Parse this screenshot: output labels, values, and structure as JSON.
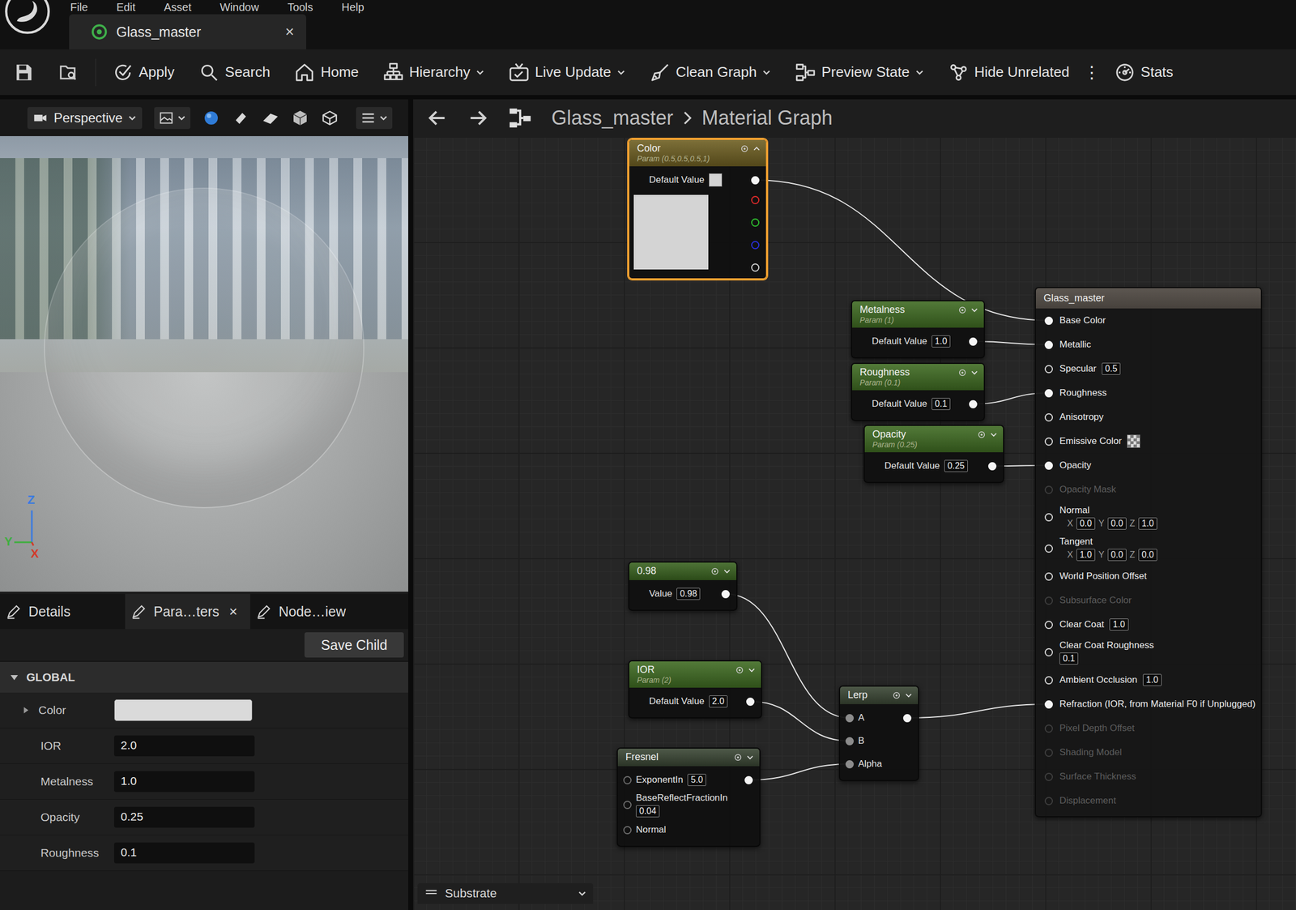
{
  "window": {
    "title": "Glass_master"
  },
  "menu": [
    "File",
    "Edit",
    "Asset",
    "Window",
    "Tools",
    "Help"
  ],
  "close_glyph": "×",
  "toolbar": [
    {
      "label": "Apply",
      "kind": "button"
    },
    {
      "label": "Search",
      "kind": "button"
    },
    {
      "label": "Home",
      "kind": "button"
    },
    {
      "label": "Hierarchy",
      "kind": "dropdown"
    },
    {
      "label": "Live Update",
      "kind": "dropdown"
    },
    {
      "label": "Clean Graph",
      "kind": "dropdown"
    },
    {
      "label": "Preview State",
      "kind": "dropdown"
    },
    {
      "label": "Hide Unrelated",
      "kind": "button"
    },
    {
      "label": "⋮",
      "kind": "more"
    },
    {
      "label": "Stats",
      "kind": "button"
    }
  ],
  "viewport": {
    "view": "Perspective",
    "axes": [
      {
        "label": "Z",
        "color": "#3b7be0"
      },
      {
        "label": "Y",
        "color": "#3fae3f"
      },
      {
        "label": "X",
        "color": "#d23a2a"
      }
    ]
  },
  "panel_tabs": [
    {
      "label": "Details",
      "selected": false,
      "closable": false
    },
    {
      "label": "Para…ters",
      "selected": true,
      "closable": true
    },
    {
      "label": "Node…iew",
      "selected": false,
      "closable": false
    }
  ],
  "details": {
    "save_button": "Save Child",
    "section": {
      "label": "GLOBAL",
      "expanded": true
    },
    "params": [
      {
        "label": "Color",
        "kind": "color",
        "value": "#dadada",
        "expanded": false
      },
      {
        "label": "IOR",
        "kind": "number",
        "value": "2.0"
      },
      {
        "label": "Metalness",
        "kind": "number",
        "value": "1.0"
      },
      {
        "label": "Opacity",
        "kind": "number",
        "value": "0.25"
      },
      {
        "label": "Roughness",
        "kind": "number",
        "value": "0.1"
      }
    ]
  },
  "graph": {
    "breadcrumb": [
      "Glass_master",
      "Material Graph"
    ],
    "nodes": [
      {
        "title": "Color",
        "subtitle": "Param (0.5,0.5,0.5,1)",
        "color": "#6e5f22",
        "selected": true,
        "expanded": true,
        "preview": "#d4d4d4",
        "channels": [
          "#e02a2a",
          "#2ec02e",
          "#2a30e0",
          "#d0d0d0"
        ],
        "rows": [
          {
            "label": "Default Value",
            "swatch": "#d4d4d4",
            "input": false,
            "connected": false,
            "output": true,
            "below": false
          }
        ]
      },
      {
        "title": "Metalness",
        "subtitle": "Param (1)",
        "color": "#3f6b22",
        "selected": false,
        "expanded": false,
        "rows": [
          {
            "label": "Default Value",
            "value": "1.0",
            "input": false,
            "connected": false,
            "output": true,
            "below": false
          }
        ]
      },
      {
        "title": "Roughness",
        "subtitle": "Param (0.1)",
        "color": "#3f6b22",
        "selected": false,
        "expanded": false,
        "rows": [
          {
            "label": "Default Value",
            "value": "0.1",
            "input": false,
            "connected": false,
            "output": true,
            "below": false
          }
        ]
      },
      {
        "title": "Opacity",
        "subtitle": "Param (0.25)",
        "color": "#3f6b22",
        "selected": false,
        "expanded": false,
        "rows": [
          {
            "label": "Default Value",
            "value": "0.25",
            "input": false,
            "connected": false,
            "output": true,
            "below": false
          }
        ]
      },
      {
        "title": "0.98",
        "color": "#3a6320",
        "selected": false,
        "expanded": false,
        "rows": [
          {
            "label": "Value",
            "value": "0.98",
            "input": false,
            "connected": false,
            "output": true,
            "below": false
          }
        ]
      },
      {
        "title": "IOR",
        "subtitle": "Param (2)",
        "color": "#3f6b22",
        "selected": false,
        "expanded": false,
        "rows": [
          {
            "label": "Default Value",
            "value": "2.0",
            "input": false,
            "connected": false,
            "output": true,
            "below": false
          }
        ]
      },
      {
        "title": "Fresnel",
        "color": "#3a4634",
        "selected": false,
        "expanded": false,
        "rows": [
          {
            "label": "ExponentIn",
            "value": "5.0",
            "input": true,
            "connected": false,
            "output": true,
            "below": false
          },
          {
            "label": "BaseReflectFractionIn",
            "value": "0.04",
            "input": true,
            "connected": false,
            "output": false,
            "below": true
          },
          {
            "label": "Normal",
            "input": true,
            "connected": false,
            "output": false,
            "below": false
          }
        ]
      },
      {
        "title": "Lerp",
        "color": "#3a4634",
        "selected": false,
        "expanded": false,
        "rows": [
          {
            "label": "A",
            "input": true,
            "connected": true,
            "output": true,
            "below": false
          },
          {
            "label": "B",
            "input": true,
            "connected": true,
            "output": false,
            "below": false
          },
          {
            "label": "Alpha",
            "input": true,
            "connected": true,
            "output": false,
            "below": false
          }
        ]
      }
    ],
    "material": {
      "title": "Glass_master",
      "rows": [
        {
          "label": "Base Color",
          "kind": "pin",
          "connected": true,
          "enabled": true
        },
        {
          "label": "Metallic",
          "kind": "pin",
          "connected": true,
          "enabled": true
        },
        {
          "label": "Specular",
          "kind": "value",
          "value": "0.5",
          "connected": false,
          "enabled": true
        },
        {
          "label": "Roughness",
          "kind": "pin",
          "connected": true,
          "enabled": true
        },
        {
          "label": "Anisotropy",
          "kind": "pin",
          "connected": false,
          "enabled": true
        },
        {
          "label": "Emissive Color",
          "kind": "swatch",
          "connected": false,
          "enabled": true
        },
        {
          "label": "Opacity",
          "kind": "pin",
          "connected": true,
          "enabled": true
        },
        {
          "label": "Opacity Mask",
          "kind": "pin",
          "connected": false,
          "enabled": false
        },
        {
          "label": "Normal",
          "kind": "vector",
          "connected": false,
          "enabled": true,
          "values": [
            {
              "axis": "X",
              "value": "0.0"
            },
            {
              "axis": "Y",
              "value": "0.0"
            },
            {
              "axis": "Z",
              "value": "1.0"
            }
          ]
        },
        {
          "label": "Tangent",
          "kind": "vector",
          "connected": false,
          "enabled": true,
          "values": [
            {
              "axis": "X",
              "value": "1.0"
            },
            {
              "axis": "Y",
              "value": "0.0"
            },
            {
              "axis": "Z",
              "value": "0.0"
            }
          ]
        },
        {
          "label": "World Position Offset",
          "kind": "pin",
          "connected": false,
          "enabled": true
        },
        {
          "label": "Subsurface Color",
          "kind": "pin",
          "connected": false,
          "enabled": false
        },
        {
          "label": "Clear Coat",
          "kind": "value",
          "value": "1.0",
          "connected": false,
          "enabled": true
        },
        {
          "label": "Clear Coat Roughness",
          "kind": "value-below",
          "value": "0.1",
          "connected": false,
          "enabled": true
        },
        {
          "label": "Ambient Occlusion",
          "kind": "value",
          "value": "1.0",
          "connected": false,
          "enabled": true
        },
        {
          "label": "Refraction (IOR, from Material F0 if Unplugged)",
          "kind": "pin",
          "connected": true,
          "enabled": true
        },
        {
          "label": "Pixel Depth Offset",
          "kind": "pin",
          "connected": false,
          "enabled": false
        },
        {
          "label": "Shading Model",
          "kind": "pin",
          "connected": false,
          "enabled": false
        },
        {
          "label": "Surface Thickness",
          "kind": "pin",
          "connected": false,
          "enabled": false
        },
        {
          "label": "Displacement",
          "kind": "pin",
          "connected": false,
          "enabled": false
        }
      ]
    },
    "wires": [
      {
        "from": "Color",
        "to": "Glass_master",
        "pin": "Base Color"
      },
      {
        "from": "Metalness",
        "to": "Glass_master",
        "pin": "Metallic"
      },
      {
        "from": "Roughness",
        "to": "Glass_master",
        "pin": "Roughness"
      },
      {
        "from": "Opacity",
        "to": "Glass_master",
        "pin": "Opacity"
      },
      {
        "from": "0.98",
        "to": "Lerp",
        "pin": "A"
      },
      {
        "from": "IOR",
        "to": "Lerp",
        "pin": "B"
      },
      {
        "from": "Fresnel",
        "to": "Lerp",
        "pin": "Alpha"
      },
      {
        "from": "Lerp",
        "to": "Glass_master",
        "pin": "Refraction (IOR, from Material F0 if Unplugged)"
      }
    ],
    "bottom_tab": {
      "label": "Substrate"
    }
  }
}
